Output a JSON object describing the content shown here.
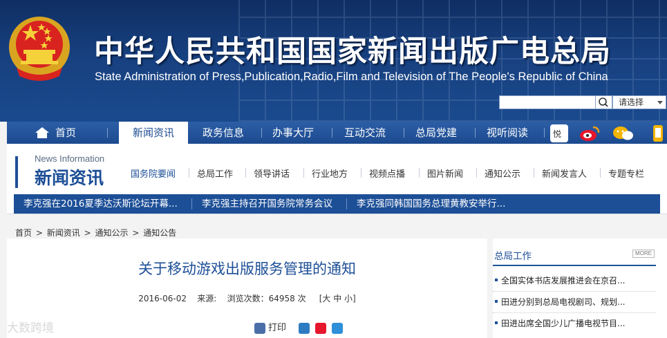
{
  "header": {
    "title_cn": "中华人民共和国国家新闻出版广电总局",
    "title_en": "State Administration of Press,Publication,Radio,Film and Television of The People's Republic of China",
    "search": {
      "placeholder": "",
      "select_label": "请选择"
    }
  },
  "nav": {
    "items": [
      {
        "label": "首页"
      },
      {
        "label": "新闻资讯"
      },
      {
        "label": "政务信息"
      },
      {
        "label": "办事大厅"
      },
      {
        "label": "互动交流"
      },
      {
        "label": "总局党建"
      },
      {
        "label": "视听阅读"
      }
    ],
    "active_index": 1
  },
  "section": {
    "en": "News Information",
    "cn": "新闻资讯",
    "sub_items": [
      {
        "label": "国务院要闻"
      },
      {
        "label": "总局工作"
      },
      {
        "label": "领导讲话"
      },
      {
        "label": "行业地方"
      },
      {
        "label": "视频点播"
      },
      {
        "label": "图片新闻"
      },
      {
        "label": "通知公示"
      },
      {
        "label": "新闻发言人"
      },
      {
        "label": "专题专栏"
      }
    ],
    "ticker": [
      "李克强在2016夏季达沃斯论坛开幕...",
      "李克强主持召开国务院常务会议",
      "李克强同韩国国务总理黄教安举行..."
    ]
  },
  "breadcrumb": [
    "首页",
    "新闻资讯",
    "通知公示",
    "通知公告"
  ],
  "breadcrumb_sep": ">",
  "article": {
    "title": "关于移动游戏出版服务管理的通知",
    "date": "2016-06-02",
    "source_label": "来源:",
    "views_label": "浏览次数：",
    "views": "64958",
    "views_unit": "次",
    "font_size_options": "[大 中 小]",
    "print_label": "打印"
  },
  "sidebar": {
    "title": "总局工作",
    "more_label": "MORE",
    "items": [
      "全国实体书店发展推进会在京召...",
      "田进分别到总局电视剧司、规划...",
      "田进出席全国少儿广播电视节目..."
    ]
  },
  "watermark": "大数跨境",
  "colors": {
    "brand_blue": "#1d4f97",
    "header_dark": "#0f2e63",
    "nav_blue": "#2c5ea6"
  }
}
